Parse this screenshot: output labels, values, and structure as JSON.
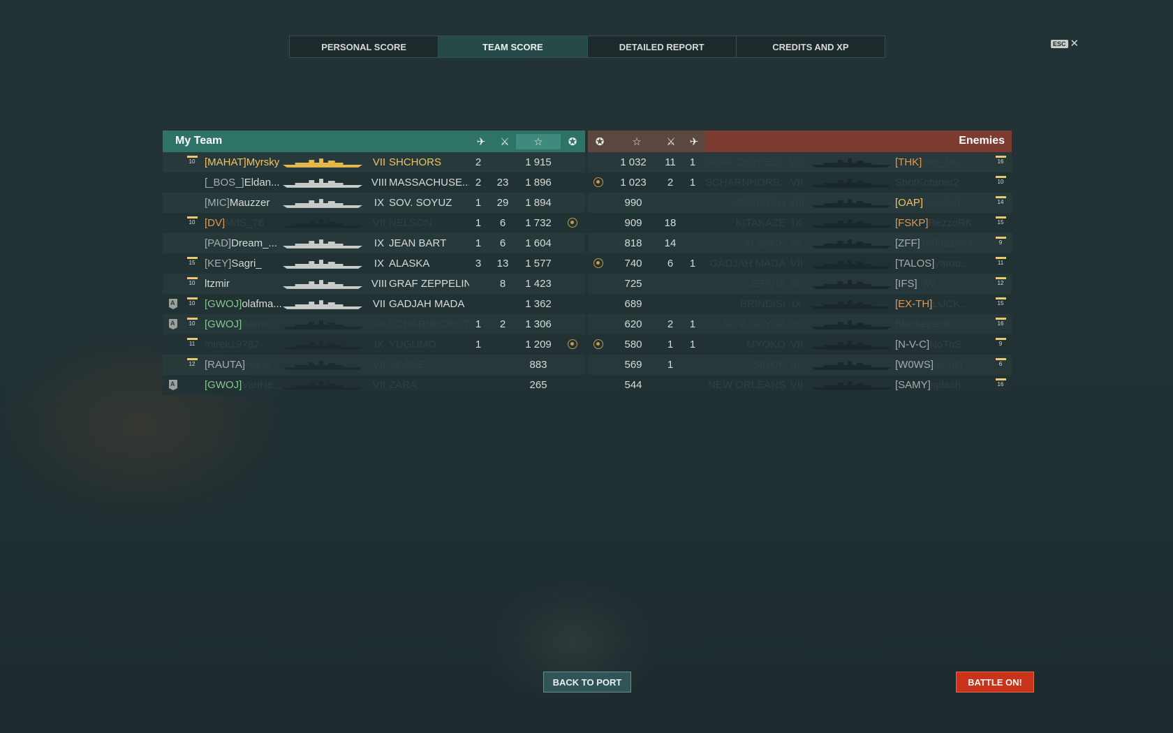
{
  "tabs": [
    {
      "label": "PERSONAL SCORE",
      "active": false
    },
    {
      "label": "TEAM SCORE",
      "active": true
    },
    {
      "label": "DETAILED REPORT",
      "active": false
    },
    {
      "label": "CREDITS AND XP",
      "active": false
    }
  ],
  "esc": {
    "key": "ESC",
    "close": "✕"
  },
  "header": {
    "my_team": "My Team",
    "enemies": "Enemies",
    "icons": [
      "plane-icon",
      "crossed-swords-icon",
      "star-icon",
      "laurel-icon"
    ]
  },
  "my_team": [
    {
      "badge": "10",
      "clan": "[MAHAT]",
      "player": "Myrsky",
      "tier": "VII",
      "ship": "SHCHORS",
      "c1": "2",
      "c2": "",
      "xp": "1 915",
      "laurel": false,
      "highlight": true,
      "dead": false,
      "clan_color": "yellow"
    },
    {
      "badge": "",
      "clan": "[_BOS_]",
      "player": "Eldan...",
      "tier": "VIII",
      "ship": "MASSACHUSE...",
      "c1": "2",
      "c2": "23",
      "xp": "1 896",
      "laurel": false,
      "dead": false,
      "clan_color": "gray"
    },
    {
      "badge": "",
      "clan": "[MIC]",
      "player": "Mauzzer",
      "tier": "IX",
      "ship": "SOV. SOYUZ",
      "c1": "1",
      "c2": "29",
      "xp": "1 894",
      "laurel": false,
      "dead": false,
      "clan_color": "gray"
    },
    {
      "badge": "10",
      "clan": "[DV]",
      "player": "MdS_76",
      "tier": "VII",
      "ship": "NELSON",
      "c1": "1",
      "c2": "6",
      "xp": "1 732",
      "laurel": true,
      "dead": true,
      "clan_color": "orange"
    },
    {
      "badge": "",
      "clan": "[PAD]",
      "player": "Dream_...",
      "tier": "IX",
      "ship": "JEAN BART",
      "c1": "1",
      "c2": "6",
      "xp": "1 604",
      "laurel": false,
      "dead": false,
      "clan_color": "gray"
    },
    {
      "badge": "15",
      "clan": "[KEY]",
      "player": "Sagri_",
      "tier": "IX",
      "ship": "ALASKA",
      "c1": "3",
      "c2": "13",
      "xp": "1 577",
      "laurel": false,
      "dead": false,
      "clan_color": "gray"
    },
    {
      "badge": "10",
      "clan": "",
      "player": "ltzmir",
      "tier": "VIII",
      "ship": "GRAF ZEPPELIN",
      "c1": "",
      "c2": "8",
      "xp": "1 423",
      "laurel": false,
      "dead": false,
      "clan_color": "gray"
    },
    {
      "badge": "10",
      "clan": "[GWOJ]",
      "player": "olafma...",
      "tier": "VII",
      "ship": "GADJAH MADA",
      "c1": "",
      "c2": "",
      "xp": "1 362",
      "laurel": false,
      "dead": false,
      "clan_color": "green",
      "anchor": true
    },
    {
      "badge": "10",
      "clan": "[GWOJ]",
      "player": "Admir...",
      "tier": "VII",
      "ship": "SCHARNHORST",
      "c1": "1",
      "c2": "2",
      "xp": "1 306",
      "laurel": false,
      "dead": true,
      "clan_color": "green",
      "anchor": true
    },
    {
      "badge": "11",
      "clan": "",
      "player": "mirek19782",
      "tier": "IX",
      "ship": "YUGUMO",
      "c1": "1",
      "c2": "",
      "xp": "1 209",
      "laurel": true,
      "dead": true,
      "clan_color": "gray"
    },
    {
      "badge": "12",
      "clan": "[RAUTA]",
      "player": "Hone...",
      "tier": "VII",
      "ship": "SKÅNE",
      "c1": "",
      "c2": "",
      "xp": "883",
      "laurel": false,
      "dead": true,
      "clan_color": "gray"
    },
    {
      "badge": "",
      "clan": "[GWOJ]",
      "player": "VanHe...",
      "tier": "VII",
      "ship": "ZARA",
      "c1": "",
      "c2": "",
      "xp": "265",
      "laurel": false,
      "dead": true,
      "clan_color": "green",
      "anchor": true
    }
  ],
  "enemies": [
    {
      "laurel": false,
      "xp": "1 032",
      "c2": "11",
      "c1": "1",
      "ship": "GRAF ZEPPELIN",
      "tier": "VIII",
      "clan": "[THK]",
      "player": "Her_Ma...",
      "badge": "16",
      "dead": true,
      "clan_color": "orange"
    },
    {
      "laurel": true,
      "xp": "1 023",
      "c2": "2",
      "c1": "1",
      "ship": "SCHARNHORS...",
      "tier": "VII",
      "clan": "",
      "player": "ShotKotaner2",
      "badge": "10",
      "dead": true,
      "clan_color": "gray"
    },
    {
      "laurel": false,
      "xp": "990",
      "c2": "",
      "c1": "",
      "ship": "MONARCH",
      "tier": "VIII",
      "clan": "[OAP]",
      "player": "Scottish...",
      "badge": "14",
      "dead": true,
      "clan_color": "yellow"
    },
    {
      "laurel": false,
      "xp": "909",
      "c2": "18",
      "c1": "",
      "ship": "KITAKAZE",
      "tier": "IX",
      "clan": "[FSKP]",
      "player": "RezzoRK",
      "badge": "15",
      "dead": true,
      "clan_color": "orange"
    },
    {
      "laurel": false,
      "xp": "818",
      "c2": "14",
      "c1": "",
      "ship": "ALSACE",
      "tier": "IX",
      "clan": "[ZFF]",
      "player": "709821894",
      "badge": "9",
      "dead": true,
      "clan_color": "gray"
    },
    {
      "laurel": true,
      "xp": "740",
      "c2": "6",
      "c1": "1",
      "ship": "GADJAH MADA",
      "tier": "VII",
      "clan": "[TALOS]",
      "player": "yarou...",
      "badge": "11",
      "dead": true,
      "clan_color": "gray"
    },
    {
      "laurel": false,
      "xp": "725",
      "c2": "",
      "c1": "",
      "ship": "JERVIS",
      "tier": "VII",
      "clan": "[IFS]",
      "player": "_jW",
      "badge": "12",
      "dead": true,
      "clan_color": "gray"
    },
    {
      "laurel": false,
      "xp": "689",
      "c2": "",
      "c1": "",
      "ship": "BRINDISI",
      "tier": "IX",
      "clan": "[EX-TH]",
      "player": "LUCK...",
      "badge": "15",
      "dead": true,
      "clan_color": "orange"
    },
    {
      "laurel": false,
      "xp": "620",
      "c2": "2",
      "c1": "1",
      "ship": "SOV. SOYUZ",
      "tier": "IX",
      "clan": "",
      "player": "Blackeye003",
      "badge": "16",
      "dead": true,
      "clan_color": "gray"
    },
    {
      "laurel": true,
      "xp": "580",
      "c2": "1",
      "c1": "1",
      "ship": "MYŌKŌ",
      "tier": "VII",
      "clan": "[N-V-C]",
      "player": "NoTriS",
      "badge": "9",
      "dead": true,
      "clan_color": "gray"
    },
    {
      "laurel": false,
      "xp": "569",
      "c2": "1",
      "c1": "",
      "ship": "SINOP",
      "tier": "VII",
      "clan": "[W0WS]",
      "player": "gerald...",
      "badge": "6",
      "dead": true,
      "clan_color": "gray"
    },
    {
      "laurel": false,
      "xp": "544",
      "c2": "",
      "c1": "",
      "ship": "NEW ORLEANS",
      "tier": "VII",
      "clan": "[SAMY]",
      "player": "splash...",
      "badge": "16",
      "dead": true,
      "clan_color": "gray"
    }
  ],
  "footer": {
    "back": "BACK TO PORT",
    "battle": "BATTLE ON!"
  }
}
